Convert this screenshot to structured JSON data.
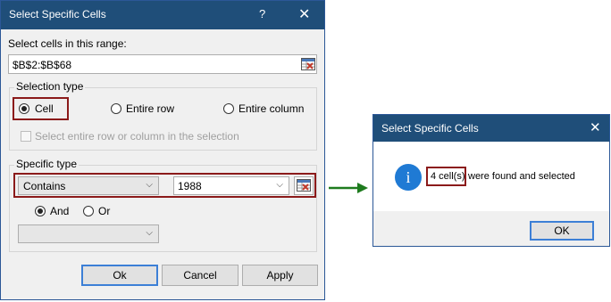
{
  "dialog1": {
    "title": "Select Specific Cells",
    "help": "?",
    "close": "✕",
    "range_label": "Select cells in this range:",
    "range_value": "$B$2:$B$68",
    "selection_type": {
      "label": "Selection type",
      "options": [
        "Cell",
        "Entire row",
        "Entire column"
      ],
      "selected": "Cell",
      "checkbox_label": "Select entire row or column in the selection"
    },
    "specific_type": {
      "label": "Specific type",
      "condition": "Contains",
      "value": "1988",
      "logic_options": [
        "And",
        "Or"
      ],
      "logic_selected": "And",
      "second_condition": ""
    },
    "buttons": {
      "ok": "Ok",
      "cancel": "Cancel",
      "apply": "Apply"
    }
  },
  "dialog2": {
    "title": "Select Specific Cells",
    "close": "✕",
    "info_glyph": "i",
    "message_count": "4 cell(s)",
    "message_rest": "were found and selected",
    "ok": "OK"
  },
  "colors": {
    "titlebar": "#1f4e79",
    "highlight": "#8b1a1a",
    "arrow": "#1e7b1e",
    "info": "#1f7ad4"
  }
}
